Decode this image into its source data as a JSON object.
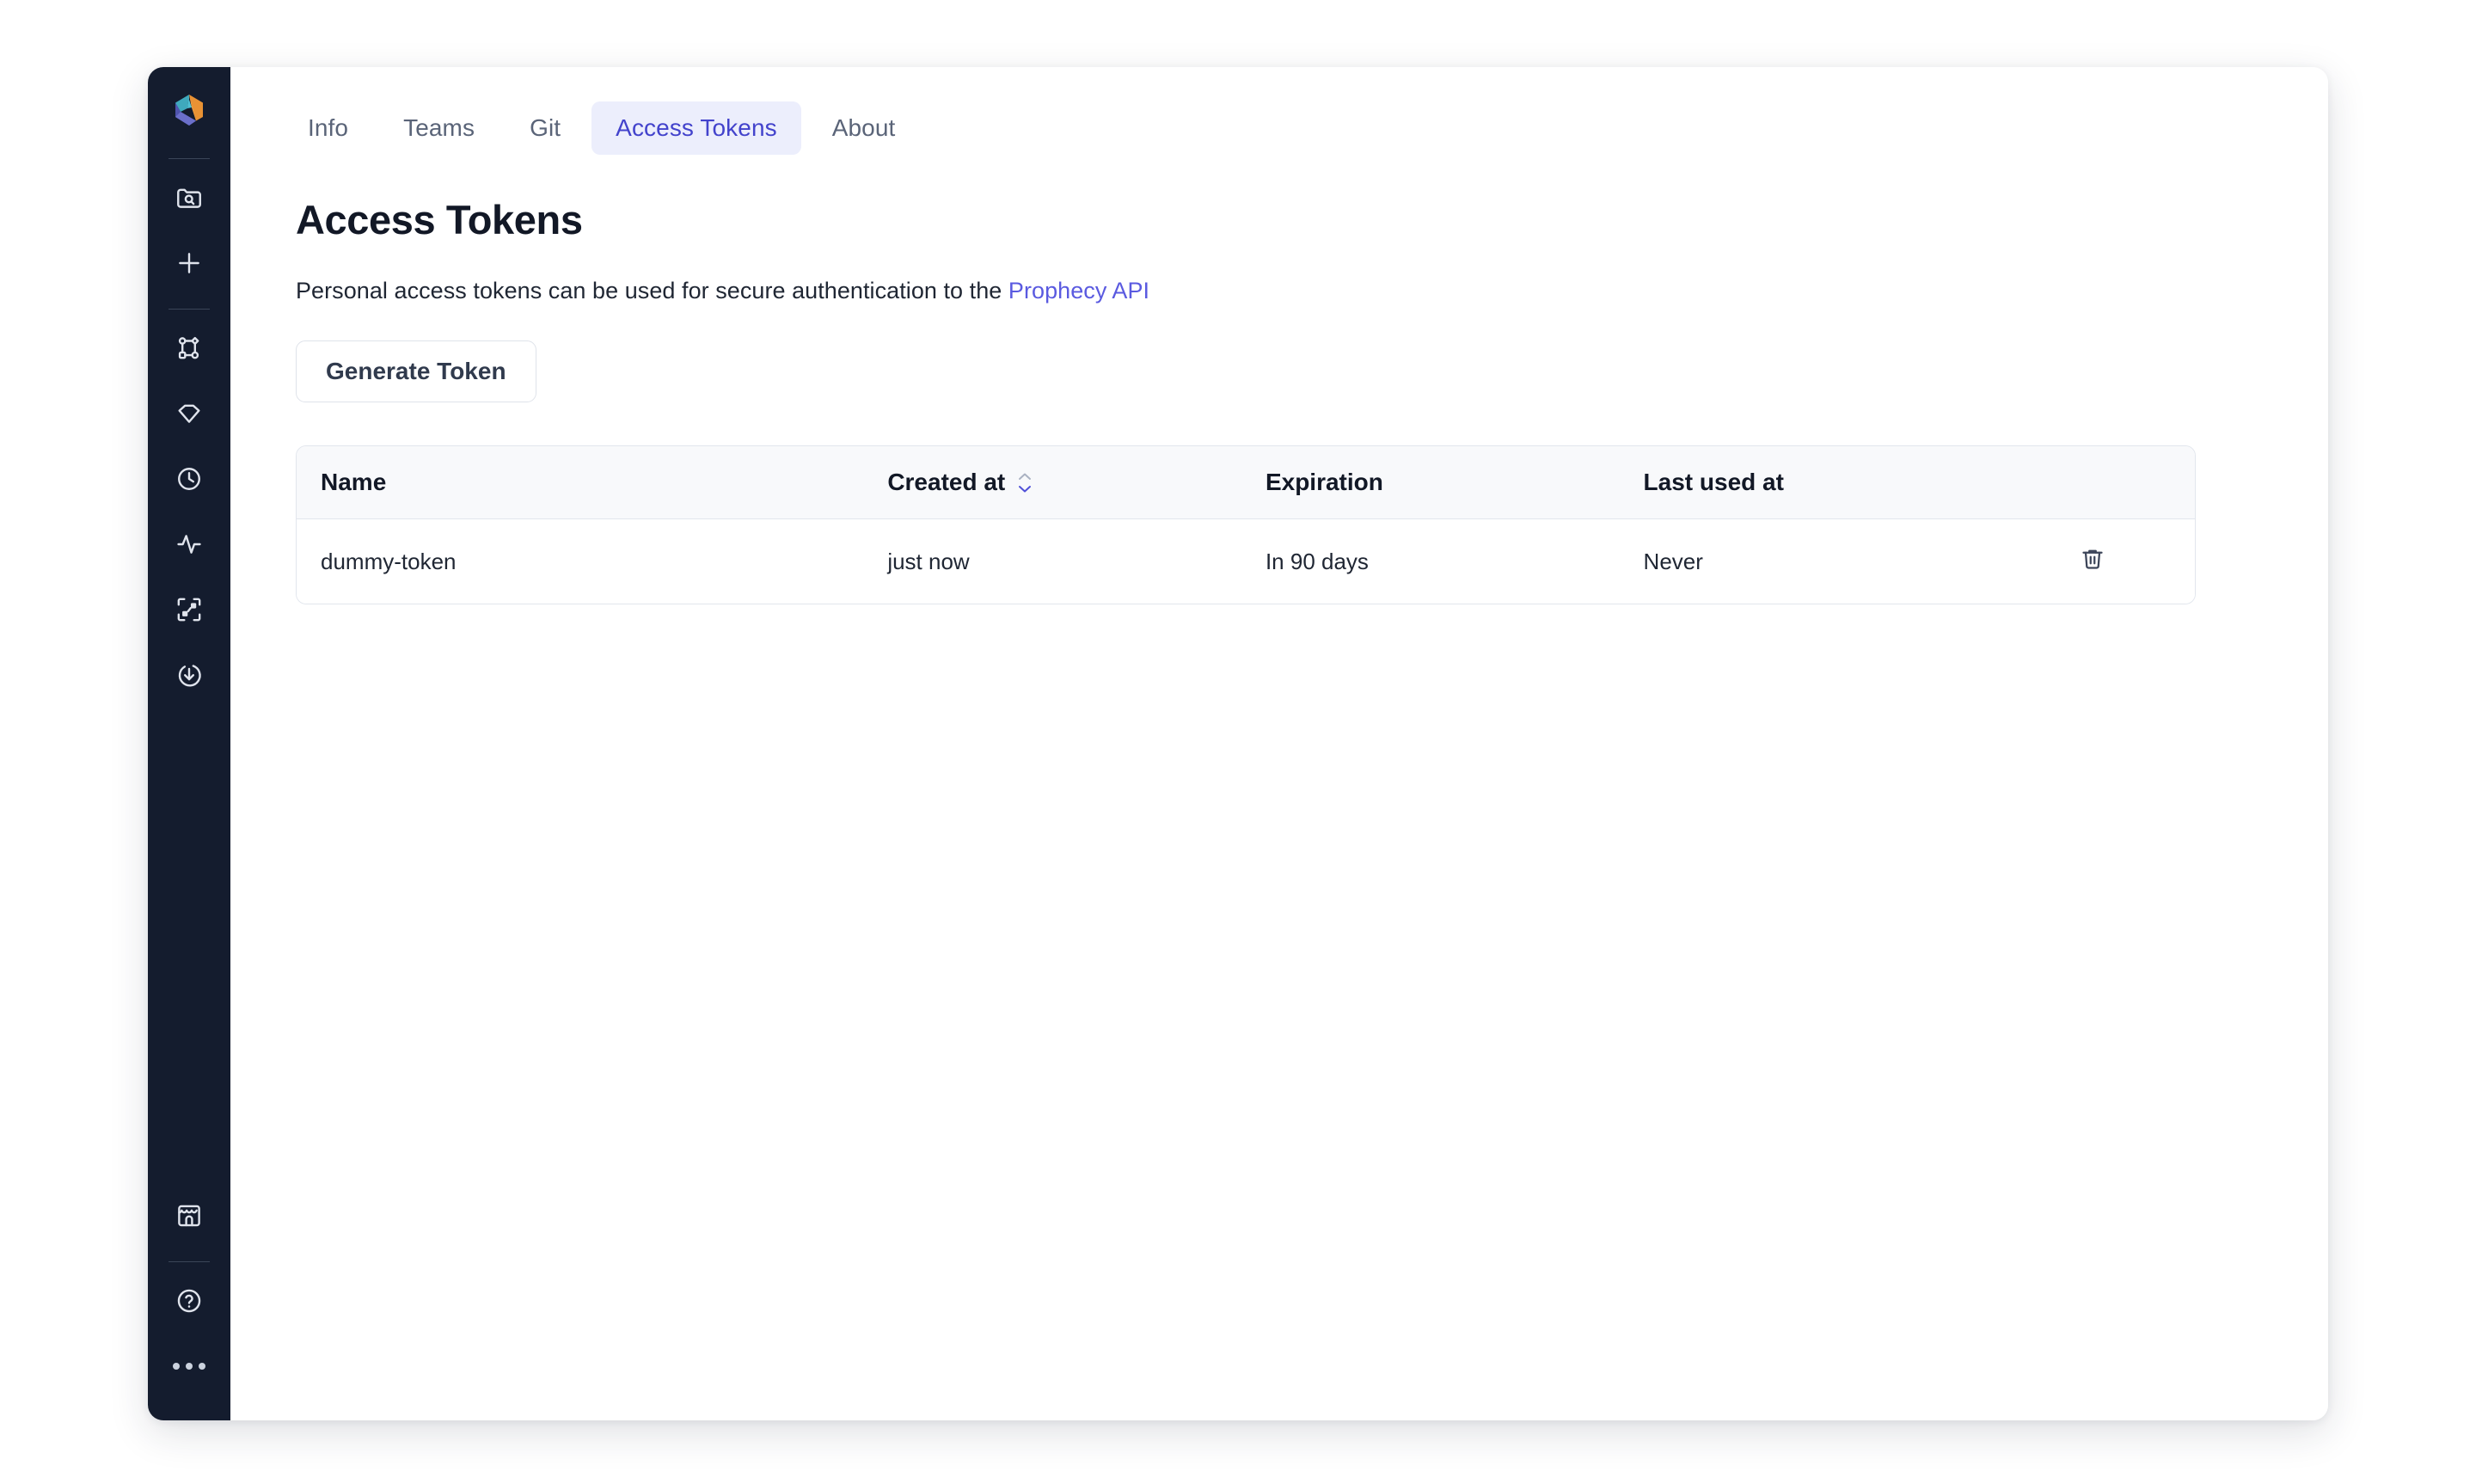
{
  "app": {
    "logo_icon": "prophecy-logo-icon"
  },
  "sidebar": {
    "items": [
      {
        "icon": "folder-search-icon",
        "name": "sidebar-item-projects"
      },
      {
        "icon": "plus-icon",
        "name": "sidebar-item-create"
      },
      {
        "icon": "pipeline-graph-icon",
        "name": "sidebar-item-pipelines"
      },
      {
        "icon": "gem-icon",
        "name": "sidebar-item-gems"
      },
      {
        "icon": "clock-icon",
        "name": "sidebar-item-scheduled"
      },
      {
        "icon": "activity-pulse-icon",
        "name": "sidebar-item-monitoring"
      },
      {
        "icon": "scan-nodes-icon",
        "name": "sidebar-item-lineage"
      },
      {
        "icon": "download-circle-icon",
        "name": "sidebar-item-deployments"
      },
      {
        "icon": "store-icon",
        "name": "sidebar-item-marketplace"
      },
      {
        "icon": "help-circle-icon",
        "name": "sidebar-item-help"
      },
      {
        "icon": "more-dots-icon",
        "name": "sidebar-item-more"
      }
    ]
  },
  "tabs": [
    {
      "label": "Info",
      "active": false
    },
    {
      "label": "Teams",
      "active": false
    },
    {
      "label": "Git",
      "active": false
    },
    {
      "label": "Access Tokens",
      "active": true
    },
    {
      "label": "About",
      "active": false
    }
  ],
  "page": {
    "title": "Access Tokens",
    "description_prefix": "Personal access tokens can be used for secure authentication to the ",
    "description_link": "Prophecy API",
    "generate_button": "Generate Token"
  },
  "table": {
    "columns": [
      {
        "label": "Name",
        "sortable": false
      },
      {
        "label": "Created at",
        "sortable": true
      },
      {
        "label": "Expiration",
        "sortable": false
      },
      {
        "label": "Last used at",
        "sortable": false
      },
      {
        "label": "",
        "sortable": false
      }
    ],
    "rows": [
      {
        "name": "dummy-token",
        "created_at": "just now",
        "expiration": "In 90 days",
        "last_used_at": "Never",
        "delete_icon": "trash-icon"
      }
    ]
  },
  "colors": {
    "sidebar_bg": "#141c2e",
    "accent_indigo": "#4343cc",
    "link": "#5a5ae0",
    "tab_active_bg": "#eceefc",
    "text_primary": "#121826",
    "text_muted": "#5a6478",
    "table_header_bg": "#f8f9fb",
    "border": "#e2e6ed"
  }
}
